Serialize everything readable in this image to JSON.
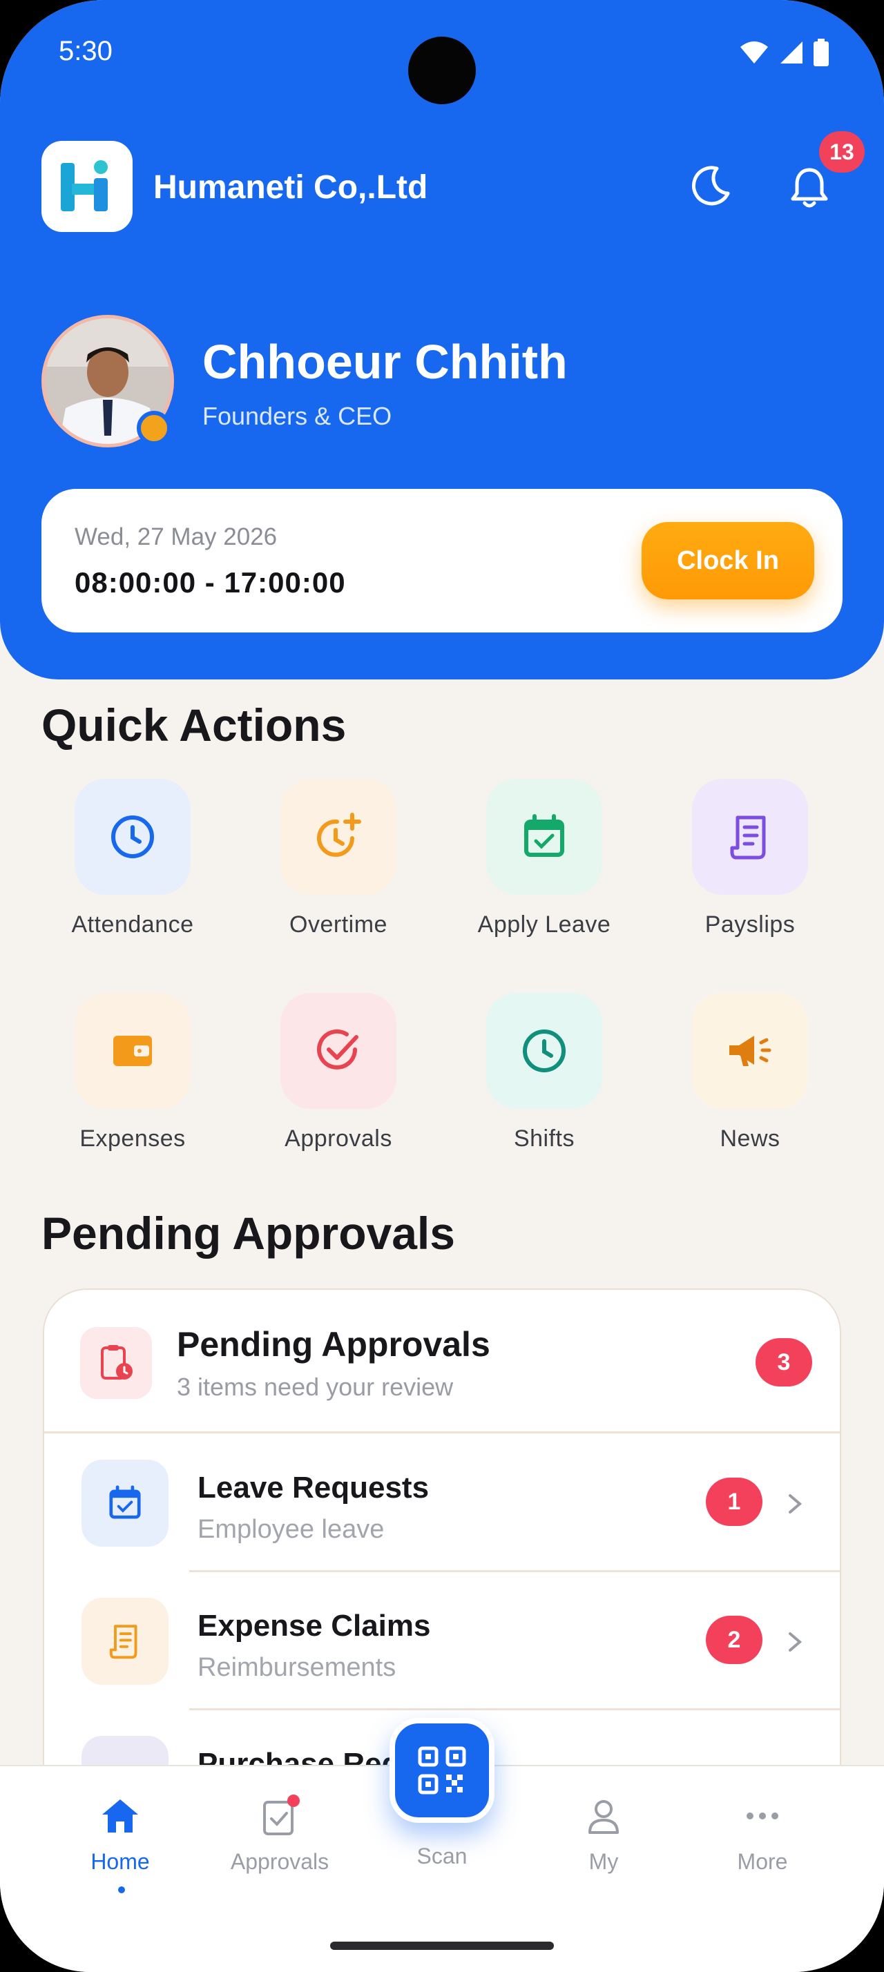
{
  "status_bar": {
    "time": "5:30",
    "icons": [
      "wifi-icon",
      "signal-icon",
      "battery-icon"
    ]
  },
  "header": {
    "company_name": "Humaneti Co,.Ltd",
    "notification_count": "13"
  },
  "profile": {
    "name": "Chhoeur Chhith",
    "role": "Founders & CEO"
  },
  "shift": {
    "date": "Wed, 27 May 2026",
    "hours": "08:00:00 - 17:00:00",
    "clock_in_label": "Clock In"
  },
  "quick_actions": {
    "title": "Quick Actions",
    "items": [
      {
        "label": "Attendance",
        "icon": "clock-icon",
        "color": "#1768ee",
        "bg": "#e7effd"
      },
      {
        "label": "Overtime",
        "icon": "clock-plus-icon",
        "color": "#f39a1a",
        "bg": "#fdf1e4"
      },
      {
        "label": "Apply Leave",
        "icon": "calendar-check-icon",
        "color": "#14a86b",
        "bg": "#e6f7ef"
      },
      {
        "label": "Payslips",
        "icon": "receipt-icon",
        "color": "#7c4de0",
        "bg": "#efe7fb"
      },
      {
        "label": "Expenses",
        "icon": "wallet-icon",
        "color": "#f39a1a",
        "bg": "#fdf1e4"
      },
      {
        "label": "Approvals",
        "icon": "check-circle-icon",
        "color": "#e8434f",
        "bg": "#fde6e8"
      },
      {
        "label": "Shifts",
        "icon": "clock-icon",
        "color": "#0f8f7c",
        "bg": "#e4f7f3"
      },
      {
        "label": "News",
        "icon": "megaphone-icon",
        "color": "#e07d10",
        "bg": "#fdf3e2"
      }
    ]
  },
  "pending": {
    "section_title": "Pending Approvals",
    "card_title": "Pending Approvals",
    "card_subtitle": "3 items need your review",
    "total": "3",
    "rows": [
      {
        "title": "Leave Requests",
        "subtitle": "Employee leave",
        "count": "1",
        "icon": "calendar-check-icon"
      },
      {
        "title": "Expense Claims",
        "subtitle": "Reimbursements",
        "count": "2",
        "icon": "receipt-icon"
      },
      {
        "title": "Purchase Requests",
        "subtitle": "",
        "count": "",
        "icon": "cart-icon"
      }
    ]
  },
  "bottom_nav": {
    "items": [
      {
        "label": "Home",
        "icon": "home-icon",
        "active": true
      },
      {
        "label": "Approvals",
        "icon": "clipboard-check-icon",
        "active": false
      },
      {
        "label": "Scan",
        "icon": "qr-code-icon",
        "active": false
      },
      {
        "label": "My",
        "icon": "user-icon",
        "active": false
      },
      {
        "label": "More",
        "icon": "more-dots-icon",
        "active": false
      }
    ]
  },
  "colors": {
    "primary": "#1768ee",
    "accent": "#ff9f0a",
    "danger": "#f3415c",
    "background": "#f6f3ee"
  }
}
